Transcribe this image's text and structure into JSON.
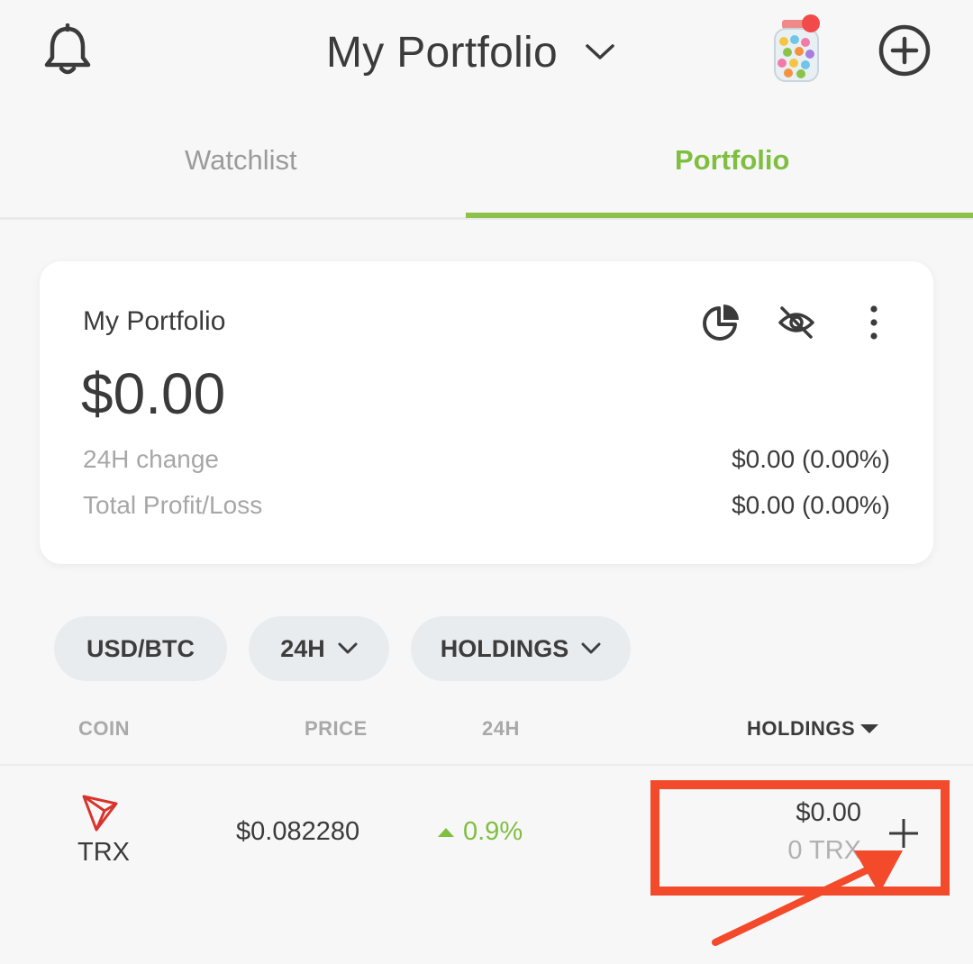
{
  "header": {
    "title": "My Portfolio",
    "bell_icon": "bell-icon",
    "chevron_icon": "chevron-down-icon",
    "jar_icon": "candy-jar-icon",
    "add_icon": "plus-circle-icon"
  },
  "tabs": [
    {
      "label": "Watchlist",
      "active": false
    },
    {
      "label": "Portfolio",
      "active": true
    }
  ],
  "summary": {
    "name": "My Portfolio",
    "total": "$0.00",
    "change_label": "24H change",
    "change_value": "$0.00 (0.00%)",
    "pl_label": "Total Profit/Loss",
    "pl_value": "$0.00 (0.00%)",
    "icons": [
      "pie-chart-icon",
      "eye-off-icon",
      "more-vertical-icon"
    ]
  },
  "filters": {
    "currency": "USD/BTC",
    "period": "24H",
    "sort": "HOLDINGS"
  },
  "columns": {
    "coin": "COIN",
    "price": "PRICE",
    "change": "24H",
    "holdings": "HOLDINGS"
  },
  "rows": [
    {
      "symbol": "TRX",
      "price": "$0.082280",
      "change": "0.9%",
      "holding_value": "$0.00",
      "holding_qty": "0 TRX"
    }
  ],
  "colors": {
    "accent": "#8cc24a",
    "positive": "#7fbf3f",
    "annotation": "#f24a2a",
    "trx_red": "#d9342b"
  }
}
